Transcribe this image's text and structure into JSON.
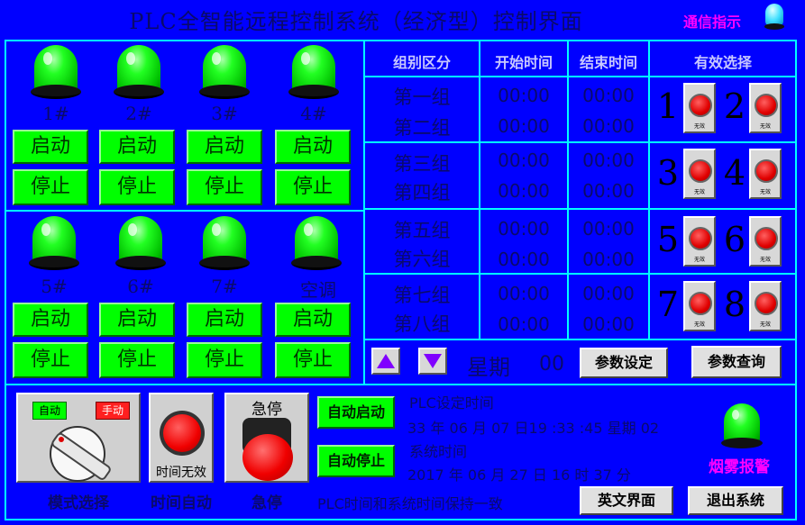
{
  "title": "PLC全智能远程控制系统（经济型）控制界面",
  "comm_indicator": "通信指示",
  "devices": [
    {
      "label": "1#",
      "start": "启动",
      "stop": "停止"
    },
    {
      "label": "2#",
      "start": "启动",
      "stop": "停止"
    },
    {
      "label": "3#",
      "start": "启动",
      "stop": "停止"
    },
    {
      "label": "4#",
      "start": "启动",
      "stop": "停止"
    },
    {
      "label": "5#",
      "start": "启动",
      "stop": "停止"
    },
    {
      "label": "6#",
      "start": "启动",
      "stop": "停止"
    },
    {
      "label": "7#",
      "start": "启动",
      "stop": "停止"
    },
    {
      "label": "空调",
      "start": "启动",
      "stop": "停止"
    }
  ],
  "table": {
    "headers": [
      "组别区分",
      "开始时间",
      "结束时间",
      "有效选择"
    ],
    "rows": [
      {
        "group": "第一组",
        "start": "00:00",
        "end": "00:00"
      },
      {
        "group": "第二组",
        "start": "00:00",
        "end": "00:00"
      },
      {
        "group": "第三组",
        "start": "00:00",
        "end": "00:00"
      },
      {
        "group": "第四组",
        "start": "00:00",
        "end": "00:00"
      },
      {
        "group": "第五组",
        "start": "00:00",
        "end": "00:00"
      },
      {
        "group": "第六组",
        "start": "00:00",
        "end": "00:00"
      },
      {
        "group": "第七组",
        "start": "00:00",
        "end": "00:00"
      },
      {
        "group": "第八组",
        "start": "00:00",
        "end": "00:00"
      }
    ],
    "select_numbers": [
      "1",
      "2",
      "3",
      "4",
      "5",
      "6",
      "7",
      "8"
    ],
    "select_button_text": "无效"
  },
  "week": {
    "label": "星期",
    "value": "00"
  },
  "buttons": {
    "param_set": "参数设定",
    "param_query": "参数查询",
    "english": "英文界面",
    "exit": "退出系统",
    "auto_start": "自动启动",
    "auto_stop": "自动停止"
  },
  "mode_switch": {
    "auto": "自动",
    "manual": "手动",
    "caption": "模式选择"
  },
  "time_auto": {
    "button_text": "时间无效",
    "caption": "时间自动"
  },
  "estop": {
    "top": "急停",
    "caption": "急停"
  },
  "plc_time": {
    "label": "PLC设定时间",
    "value": "33 年 06 月 07 日19 :33 :45  星期  02"
  },
  "sys_time": {
    "label": "系统时间",
    "value": "2017 年 06 月 27 日 16 时 37 分"
  },
  "sync_note": "PLC时间和系统时间保持一致",
  "smoke_alarm": "烟雾报警",
  "colors": {
    "background": "#0000ff",
    "border": "#00ffff",
    "button_green": "#00ff00",
    "alarm_magenta": "#ff00ff"
  }
}
